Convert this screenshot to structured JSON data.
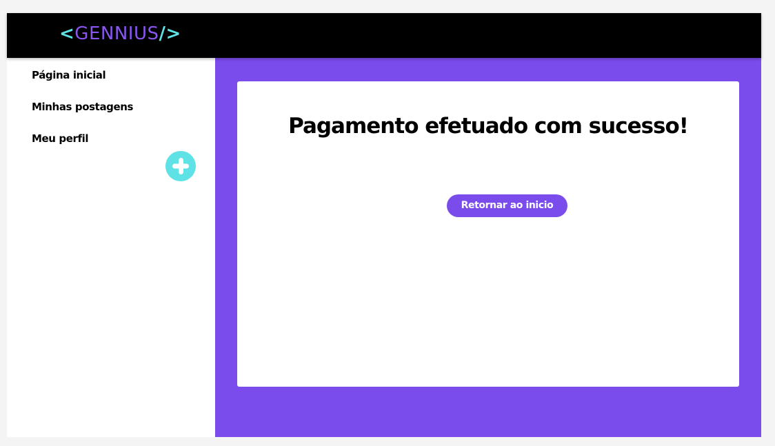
{
  "header": {
    "logo_open": "<",
    "logo_name": "GENNIUS",
    "logo_close": "/>"
  },
  "sidebar": {
    "items": [
      {
        "label": "Página inicial"
      },
      {
        "label": "Minhas postagens"
      },
      {
        "label": "Meu perfil"
      }
    ],
    "add_icon": "plus-icon"
  },
  "main": {
    "title": "Pagamento efetuado com sucesso!",
    "return_button_label": "Retornar ao inicio"
  },
  "colors": {
    "header_bg": "#000000",
    "accent_cyan": "#5ee2e6",
    "accent_purple": "#7b4cec",
    "logo_purple": "#8a56f0"
  }
}
